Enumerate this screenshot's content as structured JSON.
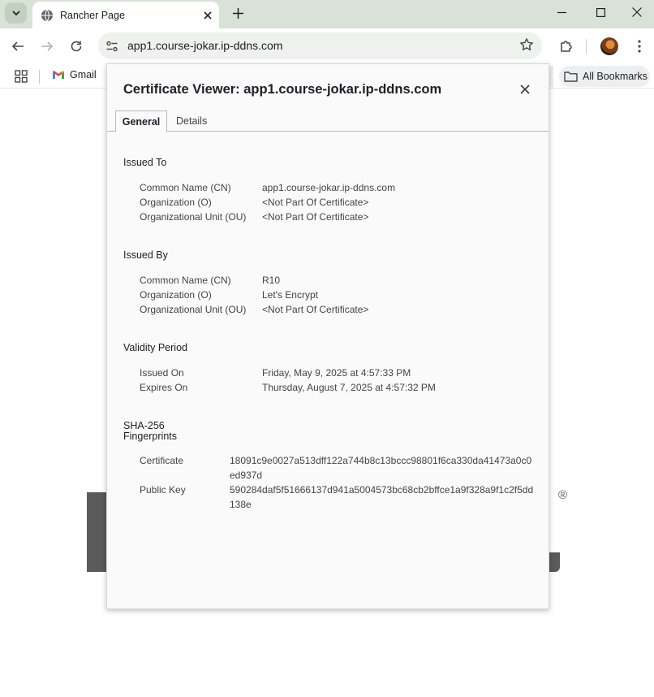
{
  "browser": {
    "tab_title": "Rancher Page",
    "url": "app1.course-jokar.ip-ddns.com",
    "bookmarks": [
      {
        "label": "Gmail",
        "icon": "gmail-icon"
      }
    ],
    "all_bookmarks_label": "All Bookmarks"
  },
  "dialog": {
    "title": "Certificate Viewer: app1.course-jokar.ip-ddns.com",
    "tabs": [
      "General",
      "Details"
    ],
    "issued_to": {
      "heading": "Issued To",
      "rows": [
        {
          "label": "Common Name (CN)",
          "value": "app1.course-jokar.ip-ddns.com"
        },
        {
          "label": "Organization (O)",
          "value": "<Not Part Of Certificate>"
        },
        {
          "label": "Organizational Unit (OU)",
          "value": "<Not Part Of Certificate>"
        }
      ]
    },
    "issued_by": {
      "heading": "Issued By",
      "rows": [
        {
          "label": "Common Name (CN)",
          "value": "R10"
        },
        {
          "label": "Organization (O)",
          "value": "Let's Encrypt"
        },
        {
          "label": "Organizational Unit (OU)",
          "value": "<Not Part Of Certificate>"
        }
      ]
    },
    "validity": {
      "heading": "Validity Period",
      "rows": [
        {
          "label": "Issued On",
          "value": "Friday, May 9, 2025 at 4:57:33 PM"
        },
        {
          "label": "Expires On",
          "value": "Thursday, August 7, 2025 at 4:57:32 PM"
        }
      ]
    },
    "fingerprints": {
      "heading_line1": "SHA-256",
      "heading_line2": "Fingerprints",
      "rows": [
        {
          "label": "Certificate",
          "value": "18091c9e0027a513dff122a744b8c13bccc98801f6ca330da41473a0c0ed937d"
        },
        {
          "label": "Public Key",
          "value": "590284daf5f51666137d941a5004573bc68cb2bffce1a9f328a9f1c2f5dd138e"
        }
      ]
    }
  },
  "background_page": {
    "registered_mark": "®"
  }
}
